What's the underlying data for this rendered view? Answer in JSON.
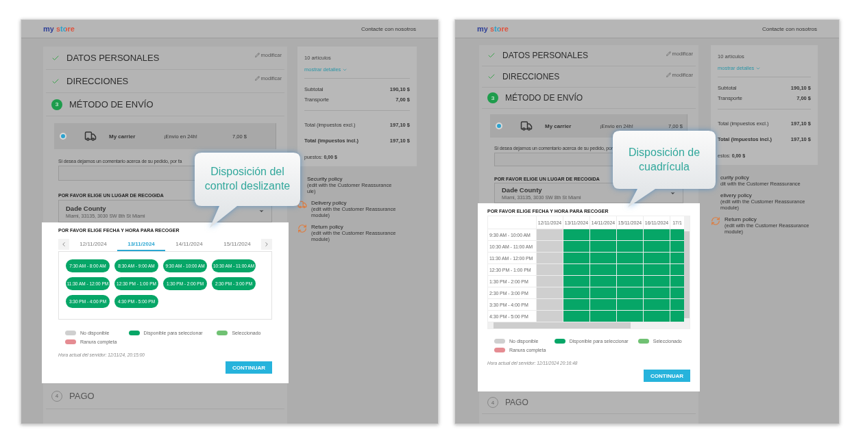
{
  "panels": [
    {
      "header": {
        "logo": "my store",
        "contact": "Contacte con nosotros"
      },
      "steps": [
        {
          "title": "DATOS PERSONALES",
          "kind": "done",
          "edit": "modificar"
        },
        {
          "title": "DIRECCIONES",
          "kind": "done",
          "edit": "modificar"
        },
        {
          "number": "3",
          "title": "MÉTODO DE ENVÍO",
          "kind": "current"
        }
      ],
      "carrier": {
        "selected": true,
        "name": "My carrier",
        "delay": "¡Envío en 24h!",
        "price": "7,00 $"
      },
      "comment_label": "Si desea dejarnos un comentario acerca de su pedido, por fa",
      "pickup": {
        "label": "POR FAVOR ELIGE UN LUGAR DE RECOGIDA",
        "name": "Dade County",
        "address": "Miami, 33135, 3030 SW 8th St Miami"
      },
      "picker": {
        "title": "POR FAVOR ELIGE FECHA Y HORA PARA RECOGER",
        "kind": "slider",
        "dates": [
          {
            "label": "12/11/2024",
            "selected": false
          },
          {
            "label": "13/11/2024",
            "selected": true
          },
          {
            "label": "14/11/2024",
            "selected": false
          },
          {
            "label": "15/11/2024",
            "selected": false
          }
        ],
        "slots": [
          {
            "time": "7:30 AM - 8:00 AM",
            "kind": "available"
          },
          {
            "time": "8:30 AM - 9:00 AM",
            "kind": "available"
          },
          {
            "time": "9:30 AM - 10:00 AM",
            "kind": "available"
          },
          {
            "time": "10:30 AM - 11:00 AM",
            "kind": "available"
          },
          {
            "time": "11:30 AM - 12:00 PM",
            "kind": "available"
          },
          {
            "time": "12:30 PM - 1:00 PM",
            "kind": "available"
          },
          {
            "time": "1:30 PM - 2:00 PM",
            "kind": "available"
          },
          {
            "time": "2:30 PM - 3:00 PM",
            "kind": "available"
          },
          {
            "time": "3:30 PM - 4:00 PM",
            "kind": "available"
          },
          {
            "time": "4:30 PM - 5:00 PM",
            "kind": "available"
          }
        ]
      },
      "legend": [
        {
          "label": "No disponible",
          "color": "#cfcfcf"
        },
        {
          "label": "Disponible para seleccionar",
          "color": "#06a667"
        },
        {
          "label": "Seleccionado",
          "color": "#70c173"
        },
        {
          "label": "Ranura completa",
          "color": "#e58c92"
        }
      ],
      "server_time": "Hora actual del servidor: 12/11/24, 20:15:00",
      "continue": "CONTINUAR",
      "next_step": {
        "number": "4",
        "title": "PAGO"
      },
      "summary": {
        "count": "10 artículos",
        "details_link": "mostrar detalles",
        "lines": [
          {
            "label": "Subtotal",
            "value": "190,10 $"
          },
          {
            "label": "Transporte",
            "value": "7,00 $"
          }
        ],
        "totals": [
          {
            "label": "Total (impuestos excl.)",
            "value": "197,10 $",
            "strong": false
          },
          {
            "label": "Total (impuestos incl.)",
            "value": "197,10 $",
            "strong": true
          }
        ],
        "taxes": "puestos: **0,00 $**"
      },
      "reassurance": [
        {
          "title": "Security policy",
          "lines": [
            "(edit with the Customer Reassurance",
            "ule)"
          ],
          "covered": true
        },
        {
          "title": "Delivery policy",
          "lines": [
            "(edit with the Customer Reassurance",
            "module)"
          ],
          "covered": false
        },
        {
          "title": "Return policy",
          "lines": [
            "(edit with the Customer Reassurance",
            "module)"
          ],
          "covered": false
        }
      ],
      "callout": "Disposición del control deslizante"
    },
    {
      "header": {
        "logo": "my store",
        "contact": "Contacte con nosotros"
      },
      "steps": [
        {
          "title": "DATOS PERSONALES",
          "kind": "done",
          "edit": "modificar"
        },
        {
          "title": "DIRECCIONES",
          "kind": "done",
          "edit": "modificar"
        },
        {
          "number": "3",
          "title": "MÉTODO DE ENVÍO",
          "kind": "current"
        }
      ],
      "carrier": {
        "selected": true,
        "name": "My carrier",
        "delay": "¡Envío en 24h!",
        "price": "7,00 $"
      },
      "comment_label": "Si desea dejarnos un comentario acerca de su pedido, por",
      "pickup": {
        "label": "POR FAVOR ELIGE UN LUGAR DE RECOGIDA",
        "name": "Dade County",
        "address": "Miami, 33135, 3030 SW 8th St Miami"
      },
      "picker": {
        "title": "POR FAVOR ELIGE FECHA Y HORA PARA RECOGER",
        "kind": "grid",
        "columns": [
          "12/11/2024",
          "13/11/2024",
          "14/11/2024",
          "15/11/2024",
          "16/11/2024",
          "17/1"
        ],
        "rows": [
          {
            "time": "9:30 AM - 10:00 AM",
            "cells": [
              {
                "kind": "unavailable"
              },
              {
                "kind": "available"
              },
              {
                "kind": "available"
              },
              {
                "kind": "available"
              },
              {
                "kind": "available"
              },
              {
                "kind": "available"
              }
            ]
          },
          {
            "time": "10:30 AM - 11:00 AM",
            "cells": [
              {
                "kind": "unavailable"
              },
              {
                "kind": "available"
              },
              {
                "kind": "available"
              },
              {
                "kind": "available"
              },
              {
                "kind": "available"
              },
              {
                "kind": "available"
              }
            ]
          },
          {
            "time": "11:30 AM - 12:00 PM",
            "cells": [
              {
                "kind": "unavailable"
              },
              {
                "kind": "available"
              },
              {
                "kind": "available"
              },
              {
                "kind": "available"
              },
              {
                "kind": "available"
              },
              {
                "kind": "available"
              }
            ]
          },
          {
            "time": "12:30 PM - 1:00 PM",
            "cells": [
              {
                "kind": "unavailable"
              },
              {
                "kind": "available"
              },
              {
                "kind": "available"
              },
              {
                "kind": "available"
              },
              {
                "kind": "available"
              },
              {
                "kind": "available"
              }
            ]
          },
          {
            "time": "1:30 PM - 2:00 PM",
            "cells": [
              {
                "kind": "unavailable"
              },
              {
                "kind": "available"
              },
              {
                "kind": "available"
              },
              {
                "kind": "available"
              },
              {
                "kind": "available"
              },
              {
                "kind": "available"
              }
            ]
          },
          {
            "time": "2:30 PM - 3:00 PM",
            "cells": [
              {
                "kind": "unavailable"
              },
              {
                "kind": "available"
              },
              {
                "kind": "available"
              },
              {
                "kind": "available"
              },
              {
                "kind": "available"
              },
              {
                "kind": "available"
              }
            ]
          },
          {
            "time": "3:30 PM - 4:00 PM",
            "cells": [
              {
                "kind": "unavailable"
              },
              {
                "kind": "available"
              },
              {
                "kind": "available"
              },
              {
                "kind": "available"
              },
              {
                "kind": "available"
              },
              {
                "kind": "available"
              }
            ]
          },
          {
            "time": "4:30 PM - 5:00 PM",
            "cells": [
              {
                "kind": "unavailable"
              },
              {
                "kind": "available"
              },
              {
                "kind": "available"
              },
              {
                "kind": "available"
              },
              {
                "kind": "available"
              },
              {
                "kind": "available"
              }
            ]
          }
        ]
      },
      "legend": [
        {
          "label": "No disponible",
          "color": "#cfcfcf"
        },
        {
          "label": "Disponible para seleccionar",
          "color": "#06a667"
        },
        {
          "label": "Seleccionado",
          "color": "#70c173"
        },
        {
          "label": "Ranura completa",
          "color": "#e58c92"
        }
      ],
      "server_time": "Hora actual del servidor: 12/11/2024 20:16:48",
      "continue": "CONTINUAR",
      "next_step": {
        "number": "4",
        "title": "PAGO"
      },
      "summary": {
        "count": "10 artículos",
        "details_link": "mostrar detalles",
        "lines": [
          {
            "label": "Subtotal",
            "value": "190,10 $"
          },
          {
            "label": "Transporte",
            "value": "7,00 $"
          }
        ],
        "totals": [
          {
            "label": "Total (impuestos excl.)",
            "value": "197,10 $",
            "strong": false
          },
          {
            "label": "Total (impuestos incl.)",
            "value": "197,10 $",
            "strong": true
          }
        ],
        "taxes": "estos: **0,00 $**"
      },
      "reassurance": [
        {
          "title": "curity policy",
          "lines": [
            "dit with the Customer Reassurance"
          ],
          "covered": true
        },
        {
          "title": "elivery policy",
          "lines": [
            "(edit with the Customer Reassurance",
            "module)"
          ],
          "covered": true
        },
        {
          "title": "Return policy",
          "lines": [
            "(edit with the Customer Reassurance",
            "module)"
          ],
          "covered": false
        }
      ],
      "callout": "Disposición de cuadrícula"
    }
  ]
}
